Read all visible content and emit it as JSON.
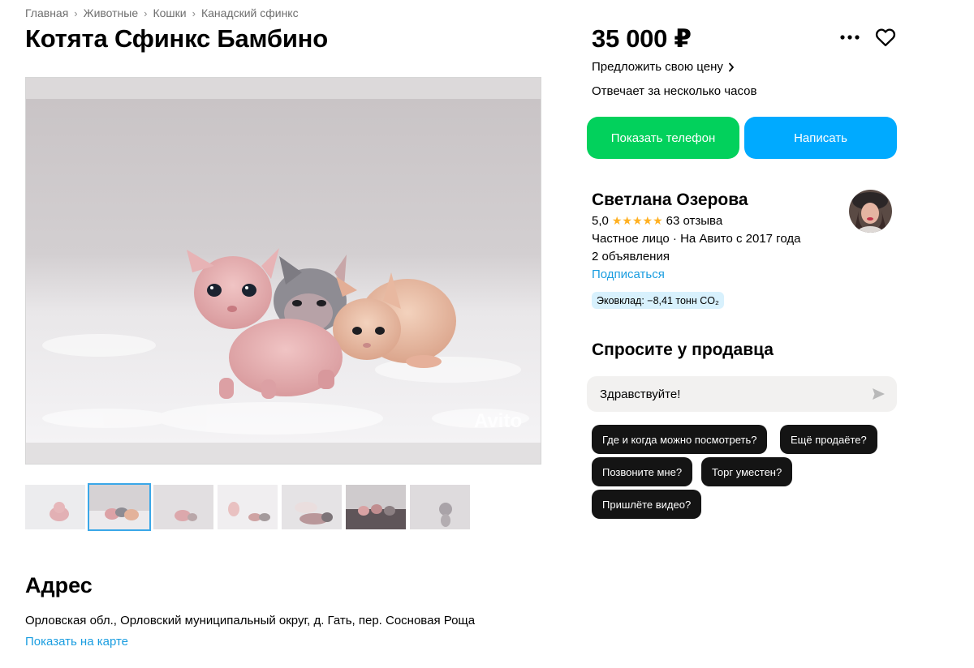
{
  "breadcrumb": [
    "Главная",
    "Животные",
    "Кошки",
    "Канадский сфинкс"
  ],
  "listing": {
    "title": "Котята Сфинкс Бамбино",
    "watermark": "Avito",
    "thumbnail_count": 7,
    "active_thumbnail": 2
  },
  "address": {
    "heading": "Адрес",
    "text": "Орловская обл., Орловский муниципальный округ, д. Гать, пер. Сосновая Роща",
    "map_link": "Показать на карте"
  },
  "price": {
    "value": "35 000 ₽",
    "offer_link": "Предложить свою цену",
    "responds": "Отвечает за несколько часов"
  },
  "actions": {
    "show_phone": "Показать телефон",
    "write": "Написать"
  },
  "seller": {
    "name": "Светлана Озерова",
    "rating": "5,0",
    "stars": "★★★★★",
    "reviews": "63 отзыва",
    "type": "Частное лицо · На Авито с 2017 года",
    "listings": "2 объявления",
    "subscribe": "Подписаться",
    "eco": "Эковклад: −8,41 тонн CO₂"
  },
  "ask": {
    "heading": "Спросите у продавца",
    "message": "Здравствуйте!",
    "chips": [
      "Где и когда можно посмотреть?",
      "Ещё продаёте?",
      "Позвоните мне?",
      "Торг уместен?",
      "Пришлёте видео?"
    ]
  },
  "colors": {
    "green": "#02d15c",
    "blue": "#00aaff",
    "link": "#1a9de0",
    "star": "#ffb021"
  },
  "icons": [
    "chevron-right-icon",
    "more-icon",
    "heart-icon",
    "send-icon"
  ]
}
